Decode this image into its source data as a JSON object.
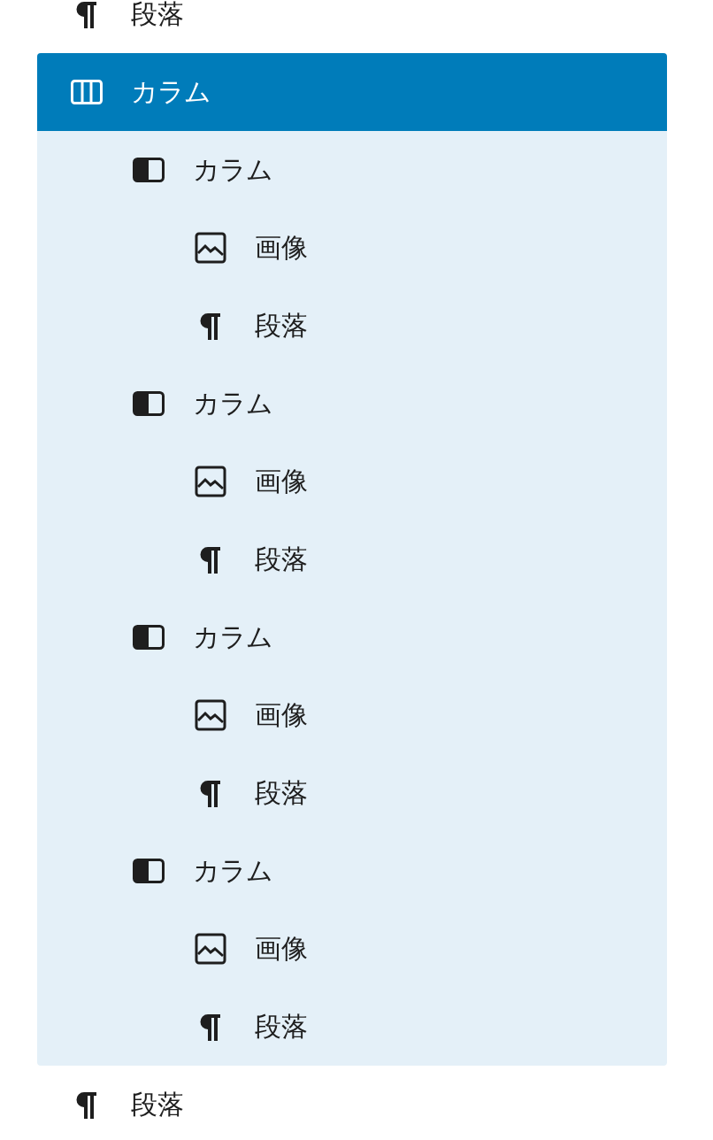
{
  "blocks": [
    {
      "kind": "paragraph",
      "label": "段落",
      "selected": false
    },
    {
      "kind": "columns",
      "label": "カラム",
      "selected": true,
      "children": [
        {
          "kind": "column",
          "label": "カラム",
          "selected": false,
          "children": [
            {
              "kind": "image",
              "label": "画像",
              "selected": false
            },
            {
              "kind": "paragraph",
              "label": "段落",
              "selected": false
            }
          ]
        },
        {
          "kind": "column",
          "label": "カラム",
          "selected": false,
          "children": [
            {
              "kind": "image",
              "label": "画像",
              "selected": false
            },
            {
              "kind": "paragraph",
              "label": "段落",
              "selected": false
            }
          ]
        },
        {
          "kind": "column",
          "label": "カラム",
          "selected": false,
          "children": [
            {
              "kind": "image",
              "label": "画像",
              "selected": false
            },
            {
              "kind": "paragraph",
              "label": "段落",
              "selected": false
            }
          ]
        },
        {
          "kind": "column",
          "label": "カラム",
          "selected": false,
          "children": [
            {
              "kind": "image",
              "label": "画像",
              "selected": false
            },
            {
              "kind": "paragraph",
              "label": "段落",
              "selected": false
            }
          ]
        }
      ]
    },
    {
      "kind": "paragraph",
      "label": "段落",
      "selected": false
    }
  ]
}
